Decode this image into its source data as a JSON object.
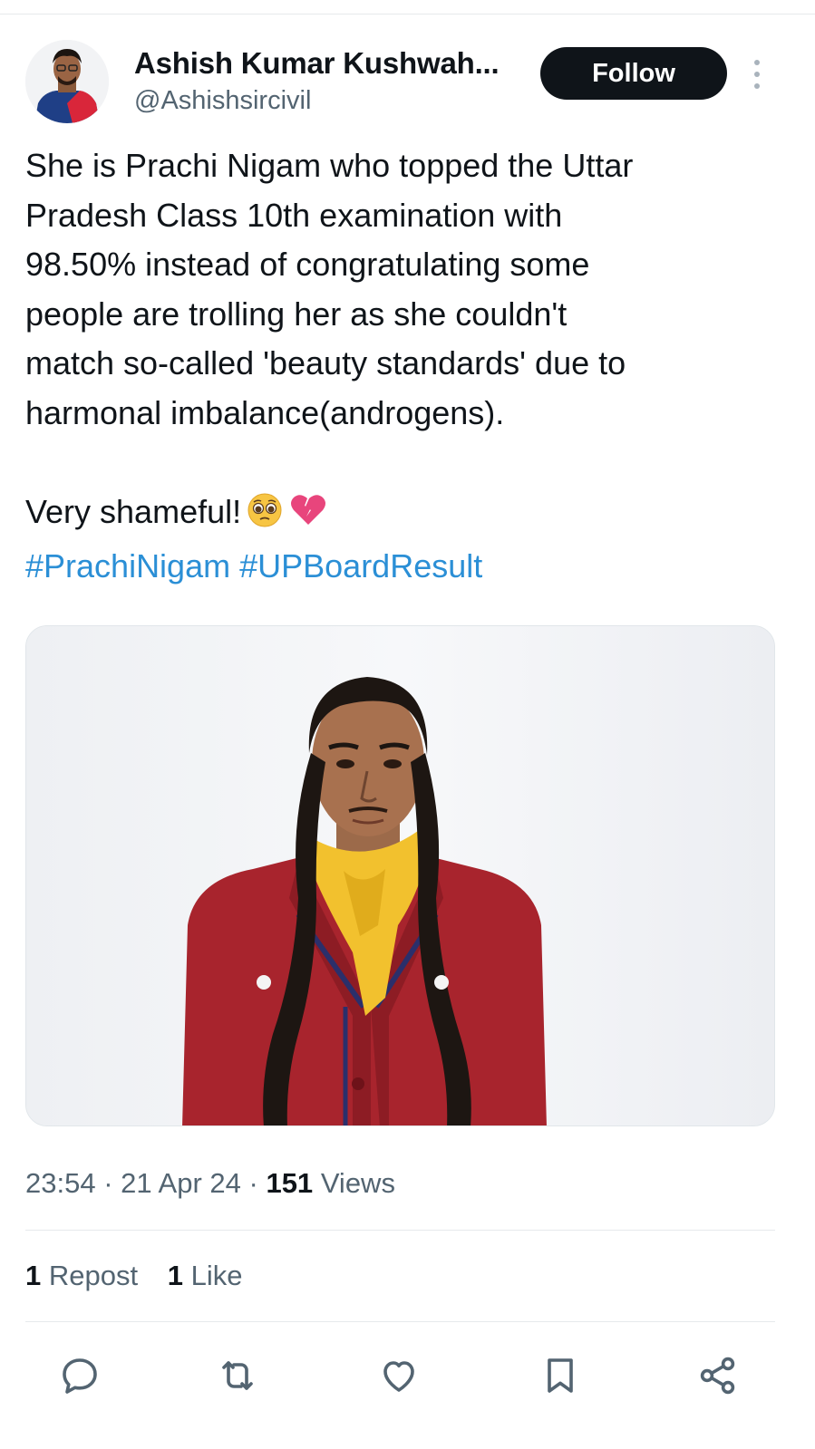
{
  "tweet": {
    "author": {
      "display_name": "Ashish Kumar Kushwah...",
      "handle": "@Ashishsircivil"
    },
    "follow_label": "Follow",
    "more_icon": "more-vertical-icon",
    "text_lines": [
      "She is Prachi Nigam who topped the Uttar",
      "Pradesh Class 10th examination with",
      "98.50% instead of congratulating some",
      "people are trolling her as she couldn't",
      "match so-called 'beauty standards' due to",
      "harmonal imbalance(androgens)."
    ],
    "closing_line": "Very shameful!",
    "emojis": [
      "pleading-face-emoji",
      "broken-heart-emoji"
    ],
    "hashtags": [
      "#PrachiNigam",
      "#UPBoardResult"
    ],
    "image": "photo",
    "meta": {
      "time": "23:54",
      "separator": "·",
      "date": "21 Apr 24",
      "views_count": "151",
      "views_label": "Views"
    },
    "engagement": {
      "reposts_count": "1",
      "reposts_label": "Repost",
      "likes_count": "1",
      "likes_label": "Like"
    },
    "actions": [
      "reply-icon",
      "repost-icon",
      "like-icon",
      "bookmark-icon",
      "share-icon"
    ]
  },
  "colors": {
    "text": "#0f1419",
    "secondary": "#536471",
    "hashtag": "#2b8fd6",
    "follow_bg": "#0f1419",
    "divider": "#e6e9ec",
    "scarf": "#f2c12e",
    "blazer": "#a8242d"
  }
}
